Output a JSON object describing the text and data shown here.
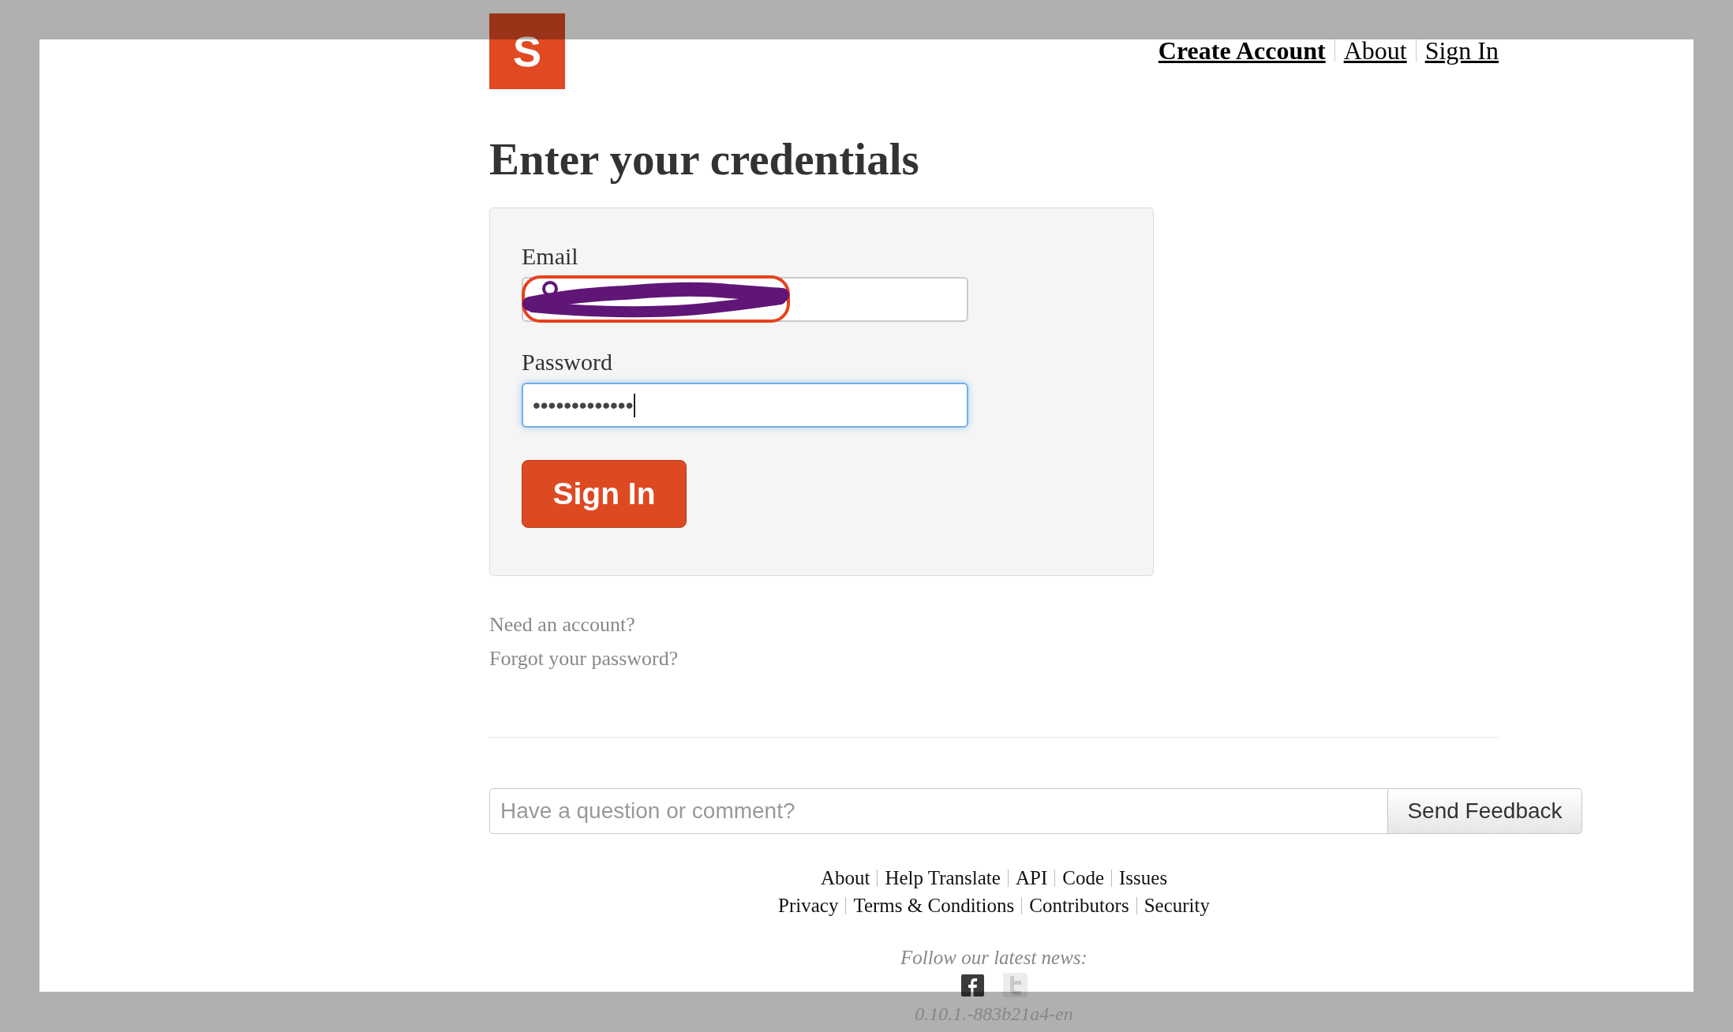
{
  "header": {
    "logo": {
      "text": "S"
    },
    "nav": [
      {
        "label": "Create Account",
        "bold": true
      },
      {
        "label": "About",
        "bold": false
      },
      {
        "label": "Sign In",
        "bold": false
      }
    ]
  },
  "title": "Enter your credentials",
  "form": {
    "fields": [
      {
        "label": "Email",
        "redacted": true,
        "focused": false
      },
      {
        "label": "Password",
        "value": "•••••••••••••",
        "redacted": false,
        "focused": true
      }
    ],
    "submit": "Sign In"
  },
  "links": [
    "Need an account?",
    "Forgot your password?"
  ],
  "feedback": {
    "placeholder": "Have a question or comment?",
    "button": "Send Feedback"
  },
  "footer": {
    "link_rows": [
      [
        "About",
        "Help Translate",
        "API",
        "Code",
        "Issues"
      ],
      [
        "Privacy",
        "Terms & Conditions",
        "Contributors",
        "Security"
      ]
    ],
    "follow_text": "Follow our latest news:",
    "social": [
      {
        "kind": "facebook",
        "faded": false
      },
      {
        "kind": "twitter",
        "faded": true
      }
    ],
    "version": "0.10.1.-883b21a4-en"
  }
}
